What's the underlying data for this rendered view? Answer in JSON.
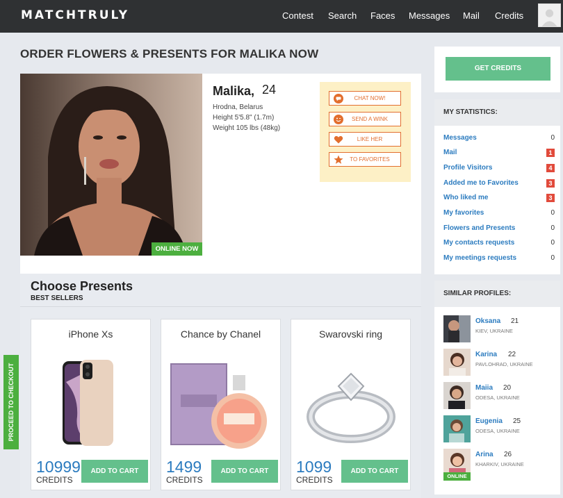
{
  "header": {
    "logo": "MATCHTRULY",
    "nav": [
      "Contest",
      "Search",
      "Faces",
      "Messages",
      "Mail",
      "Credits"
    ]
  },
  "page_title": "ORDER FLOWERS & PRESENTS FOR MALIKA NOW",
  "profile": {
    "name": "Malika,",
    "age": "24",
    "location": "Hrodna, Belarus",
    "height": "Height 5'5.8\" (1.7m)",
    "weight": "Weight 105 lbs (48kg)",
    "online_label": "ONLINE NOW",
    "actions": [
      "CHAT NOW!",
      "SEND A WINK",
      "LIKE HER",
      "TO FAVORITES"
    ]
  },
  "presents": {
    "title": "Choose Presents",
    "subtitle": "BEST SELLERS",
    "add_label": "ADD TO CART",
    "credits_label": "CREDITS",
    "items": [
      {
        "name": "iPhone Xs",
        "price": "10999"
      },
      {
        "name": "Chance by Chanel",
        "price": "1499"
      },
      {
        "name": "Swarovski ring",
        "price": "1099"
      }
    ]
  },
  "checkout": "PROCEED TO CHECKOUT",
  "sidebar": {
    "get_credits": "GET CREDITS",
    "stats_title": "MY STATISTICS:",
    "stats": [
      {
        "label": "Messages",
        "count": "0",
        "badge": false
      },
      {
        "label": "Mail",
        "count": "1",
        "badge": true
      },
      {
        "label": "Profile Visitors",
        "count": "4",
        "badge": true
      },
      {
        "label": "Added me to Favorites",
        "count": "3",
        "badge": true
      },
      {
        "label": "Who liked me",
        "count": "3",
        "badge": true
      },
      {
        "label": "My favorites",
        "count": "0",
        "badge": false
      },
      {
        "label": "Flowers and Presents",
        "count": "0",
        "badge": false
      },
      {
        "label": "My contacts requests",
        "count": "0",
        "badge": false
      },
      {
        "label": "My meetings requests",
        "count": "0",
        "badge": false
      }
    ],
    "similar_title": "SIMILAR PROFILES:",
    "similar": [
      {
        "name": "Oksana",
        "age": "21",
        "location": "KIEV, UKRAINE"
      },
      {
        "name": "Karina",
        "age": "22",
        "location": "PAVLOHRAD, UKRAINE"
      },
      {
        "name": "Maiia",
        "age": "20",
        "location": "ODESA, UKRAINE"
      },
      {
        "name": "Eugenia",
        "age": "25",
        "location": "ODESA, UKRAINE"
      },
      {
        "name": "Arina",
        "age": "26",
        "location": "KHARKIV, UKRAINE"
      }
    ],
    "online_label": "ONLINE"
  },
  "colors": {
    "header_bg": "#2f3133",
    "accent_green": "#64c08c",
    "online_green": "#4caf3f",
    "link_blue": "#2b7bbf",
    "orange": "#e26e2e",
    "badge_red": "#e14a3b"
  }
}
